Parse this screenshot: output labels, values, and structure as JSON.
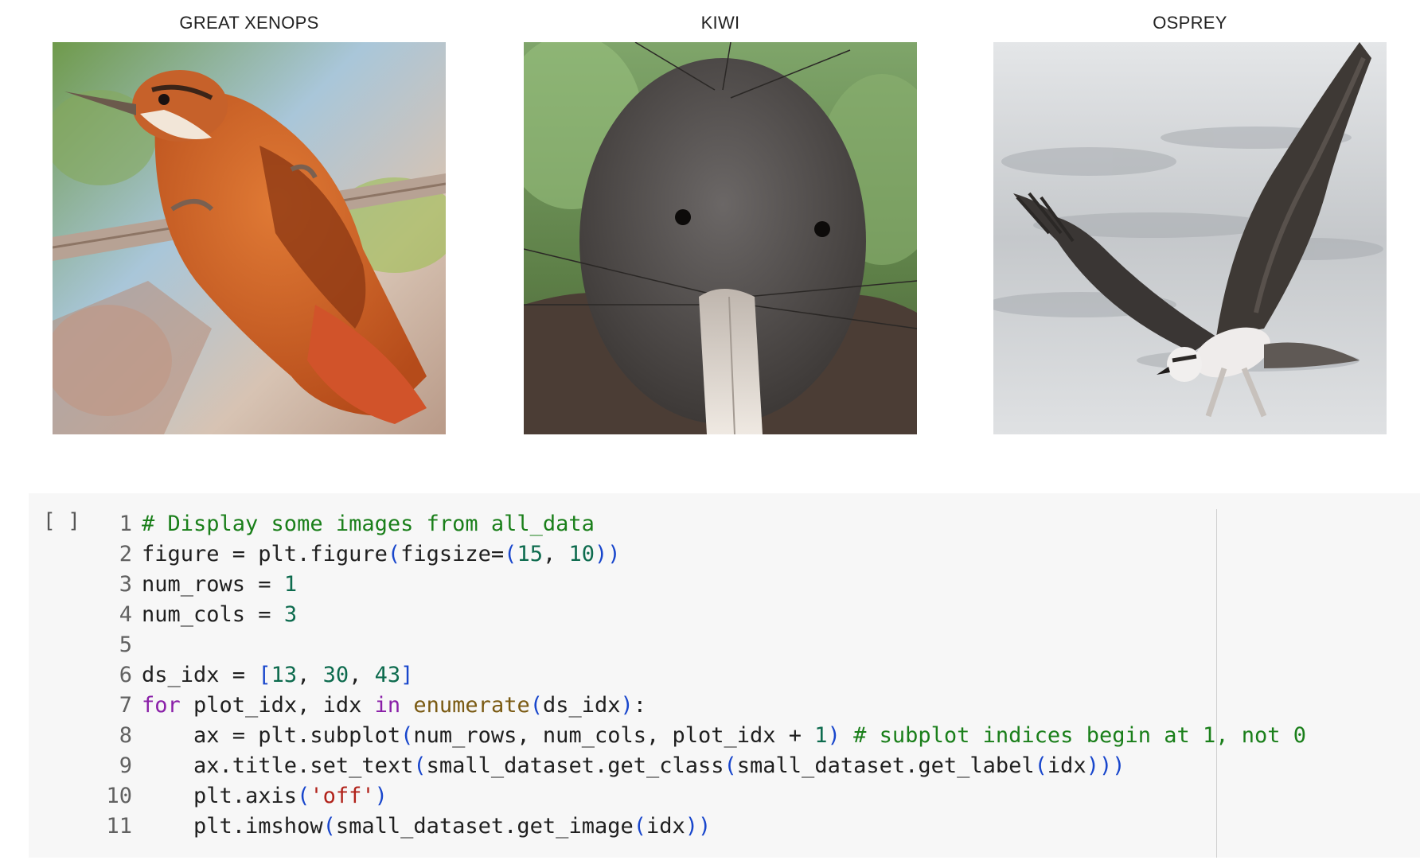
{
  "output": {
    "panels": [
      {
        "title": "GREAT XENOPS"
      },
      {
        "title": "KIWI"
      },
      {
        "title": "OSPREY"
      }
    ]
  },
  "cell": {
    "run_indicator": "[ ]",
    "lines": [
      {
        "no": "1",
        "tokens": [
          {
            "t": "comment",
            "v": "# Display some images from all_data"
          }
        ]
      },
      {
        "no": "2",
        "tokens": [
          {
            "t": "plain",
            "v": "figure = plt.figure"
          },
          {
            "t": "paren",
            "v": "("
          },
          {
            "t": "plain",
            "v": "figsize="
          },
          {
            "t": "paren",
            "v": "("
          },
          {
            "t": "number",
            "v": "15"
          },
          {
            "t": "plain",
            "v": ", "
          },
          {
            "t": "number",
            "v": "10"
          },
          {
            "t": "paren",
            "v": "))"
          }
        ]
      },
      {
        "no": "3",
        "tokens": [
          {
            "t": "plain",
            "v": "num_rows = "
          },
          {
            "t": "number",
            "v": "1"
          }
        ]
      },
      {
        "no": "4",
        "tokens": [
          {
            "t": "plain",
            "v": "num_cols = "
          },
          {
            "t": "number",
            "v": "3"
          }
        ]
      },
      {
        "no": "5",
        "tokens": []
      },
      {
        "no": "6",
        "tokens": [
          {
            "t": "plain",
            "v": "ds_idx = "
          },
          {
            "t": "paren",
            "v": "["
          },
          {
            "t": "number",
            "v": "13"
          },
          {
            "t": "plain",
            "v": ", "
          },
          {
            "t": "number",
            "v": "30"
          },
          {
            "t": "plain",
            "v": ", "
          },
          {
            "t": "number",
            "v": "43"
          },
          {
            "t": "paren",
            "v": "]"
          }
        ]
      },
      {
        "no": "7",
        "tokens": [
          {
            "t": "keyword",
            "v": "for"
          },
          {
            "t": "plain",
            "v": " plot_idx, idx "
          },
          {
            "t": "keyword",
            "v": "in"
          },
          {
            "t": "plain",
            "v": " "
          },
          {
            "t": "builtin",
            "v": "enumerate"
          },
          {
            "t": "paren",
            "v": "("
          },
          {
            "t": "plain",
            "v": "ds_idx"
          },
          {
            "t": "paren",
            "v": ")"
          },
          {
            "t": "plain",
            "v": ":"
          }
        ]
      },
      {
        "no": "8",
        "tokens": [
          {
            "t": "plain",
            "v": "    ax = plt.subplot"
          },
          {
            "t": "paren",
            "v": "("
          },
          {
            "t": "plain",
            "v": "num_rows, num_cols, plot_idx + "
          },
          {
            "t": "number",
            "v": "1"
          },
          {
            "t": "paren",
            "v": ")"
          },
          {
            "t": "plain",
            "v": " "
          },
          {
            "t": "comment",
            "v": "# subplot indices begin at 1, not 0"
          }
        ]
      },
      {
        "no": "9",
        "tokens": [
          {
            "t": "plain",
            "v": "    ax.title.set_text"
          },
          {
            "t": "paren",
            "v": "("
          },
          {
            "t": "plain",
            "v": "small_dataset.get_class"
          },
          {
            "t": "paren",
            "v": "("
          },
          {
            "t": "plain",
            "v": "small_dataset.get_label"
          },
          {
            "t": "paren",
            "v": "("
          },
          {
            "t": "plain",
            "v": "idx"
          },
          {
            "t": "paren",
            "v": ")))"
          }
        ]
      },
      {
        "no": "10",
        "tokens": [
          {
            "t": "plain",
            "v": "    plt.axis"
          },
          {
            "t": "paren",
            "v": "("
          },
          {
            "t": "string",
            "v": "'off'"
          },
          {
            "t": "paren",
            "v": ")"
          }
        ]
      },
      {
        "no": "11",
        "tokens": [
          {
            "t": "plain",
            "v": "    plt.imshow"
          },
          {
            "t": "paren",
            "v": "("
          },
          {
            "t": "plain",
            "v": "small_dataset.get_image"
          },
          {
            "t": "paren",
            "v": "("
          },
          {
            "t": "plain",
            "v": "idx"
          },
          {
            "t": "paren",
            "v": "))"
          }
        ]
      }
    ]
  }
}
